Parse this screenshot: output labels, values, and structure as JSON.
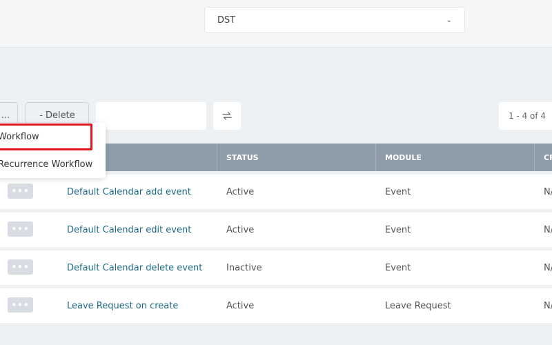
{
  "header": {
    "timezone_select": {
      "value": "DST"
    }
  },
  "toolbar": {
    "more_label": "...",
    "delete_label": "- Delete",
    "search_placeholder": "",
    "pagination": "1 - 4 of 4"
  },
  "dropdown": {
    "items": [
      {
        "label": "Workflow"
      },
      {
        "label": "Recurrence Workflow"
      }
    ]
  },
  "table": {
    "columns": [
      "",
      "STATUS",
      "MODULE",
      "CR"
    ],
    "rows": [
      {
        "name": "Default Calendar add event",
        "status": "Active",
        "module": "Event",
        "cr": "N/A"
      },
      {
        "name": "Default Calendar edit event",
        "status": "Active",
        "module": "Event",
        "cr": "N/A"
      },
      {
        "name": "Default Calendar delete event",
        "status": "Inactive",
        "module": "Event",
        "cr": "N/A"
      },
      {
        "name": "Leave Request on create",
        "status": "Active",
        "module": "Leave Request",
        "cr": "N/A"
      }
    ],
    "row_action_label": "•••"
  },
  "colors": {
    "header_bg": "#8f9dab",
    "link": "#1d6a86",
    "highlight": "#e0161c"
  }
}
